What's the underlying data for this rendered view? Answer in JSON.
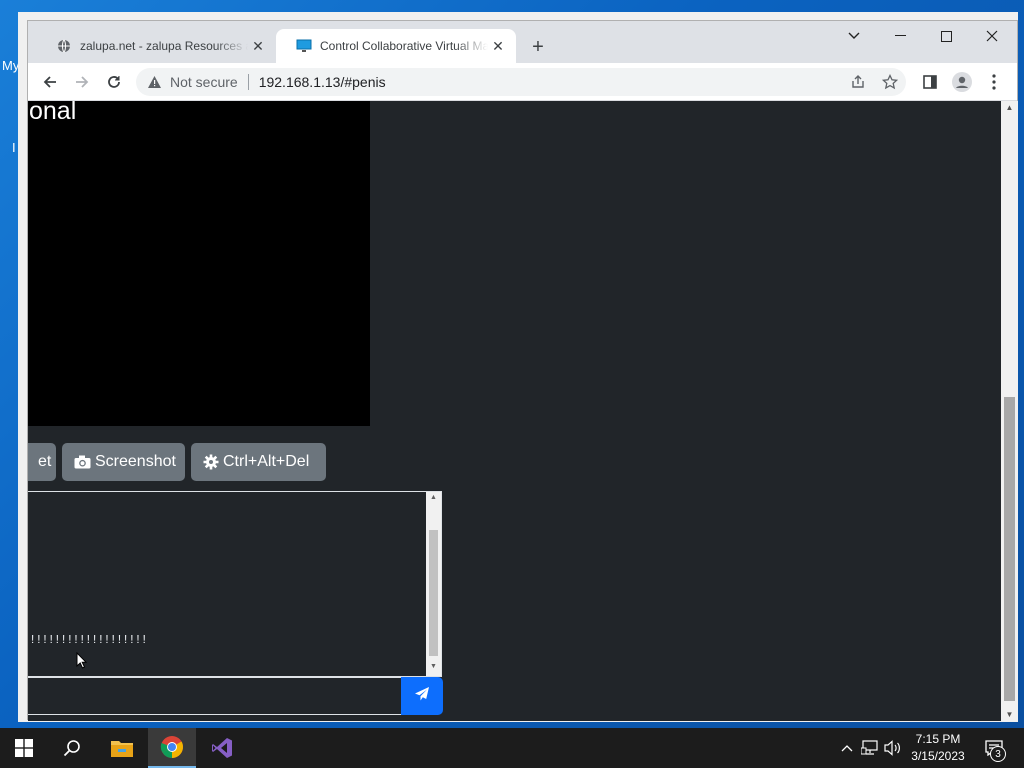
{
  "desktop": {
    "icon_label_fragment": "My",
    "icon_label_fragment2": "I"
  },
  "browser": {
    "tabs": [
      {
        "label": "zalupa.net - zalupa Resources and",
        "favicon": "globe-icon",
        "active": false
      },
      {
        "label": "Control Collaborative Virtual Mac",
        "favicon": "monitor-icon",
        "active": true
      }
    ],
    "address": {
      "security_label": "Not secure",
      "url": "192.168.1.13/#penis"
    }
  },
  "page": {
    "vm_screen_text": "onal",
    "buttons": [
      {
        "label": "et",
        "icon": ""
      },
      {
        "label": "Screenshot",
        "icon": "camera-icon"
      },
      {
        "label": "Ctrl+Alt+Del",
        "icon": "gear-icon"
      }
    ],
    "chat_line": "!!!!!!!!!!!!!!!!!!!",
    "chat_input_value": ""
  },
  "taskbar": {
    "time": "7:15 PM",
    "date": "3/15/2023",
    "notification_count": "3"
  },
  "colors": {
    "page_bg": "#212529",
    "button_gray": "#6c757d",
    "send_blue": "#0d6efd",
    "taskbar": "#1c1c1c"
  }
}
